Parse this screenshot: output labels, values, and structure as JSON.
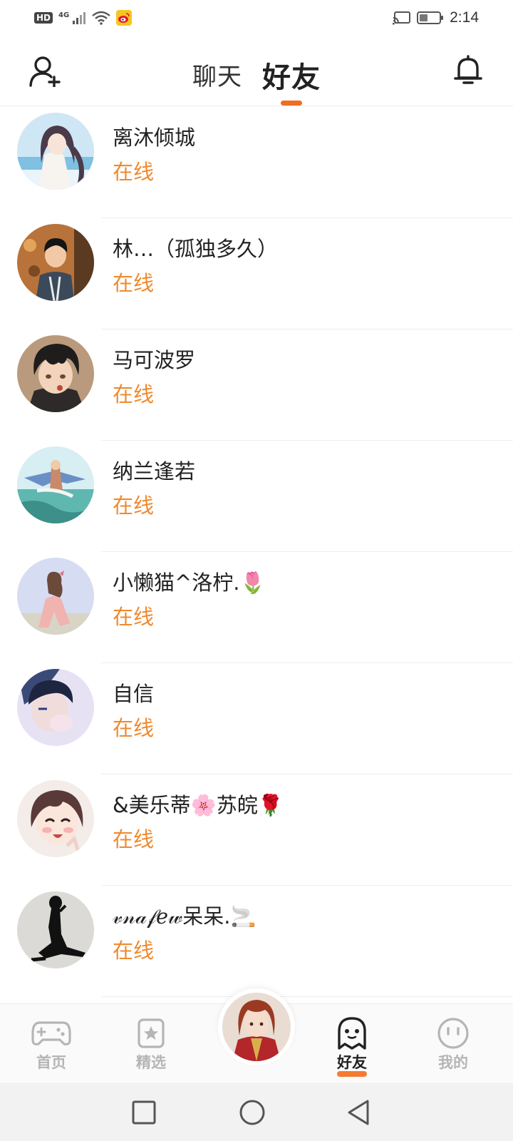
{
  "status_bar": {
    "hd": "HD",
    "network": "4G",
    "time": "2:14"
  },
  "header": {
    "tabs": [
      {
        "label": "聊天",
        "active": false
      },
      {
        "label": "好友",
        "active": true
      }
    ],
    "accent_color": "#f26d1e"
  },
  "friends": [
    {
      "name": "离沐倾城",
      "status": "在线",
      "avatar": "avatar-sea-girl"
    },
    {
      "name": "林…（孤独多久）",
      "status": "在线",
      "avatar": "avatar-butterfly-boy"
    },
    {
      "name": "马可波罗",
      "status": "在线",
      "avatar": "avatar-dark-hair-boy"
    },
    {
      "name": "纳兰逢若",
      "status": "在线",
      "avatar": "avatar-bird-rider"
    },
    {
      "name": "小懒猫^洛柠.🌷",
      "status": "在线",
      "avatar": "avatar-pink-girl"
    },
    {
      "name": "自信",
      "status": "在线",
      "avatar": "avatar-blue-boy"
    },
    {
      "name": "&美乐蒂🌸苏皖🌹",
      "status": "在线",
      "avatar": "avatar-smiling-girl"
    },
    {
      "name": "𝓋𝓃𝒶𝒻ℯ𝓌呆呆.🚬",
      "status": "在线",
      "avatar": "avatar-silhouette"
    }
  ],
  "status_color": "#ef8a2f",
  "bottom_nav": {
    "items": [
      {
        "label": "首页",
        "icon": "gamepad-icon",
        "active": false
      },
      {
        "label": "精选",
        "icon": "star-card-icon",
        "active": false
      },
      {
        "label": "",
        "icon": "center-avatar",
        "active": false
      },
      {
        "label": "好友",
        "icon": "ghost-icon",
        "active": true
      },
      {
        "label": "我的",
        "icon": "face-icon",
        "active": false
      }
    ]
  },
  "system_nav": [
    "square-icon",
    "circle-icon",
    "triangle-back-icon"
  ]
}
